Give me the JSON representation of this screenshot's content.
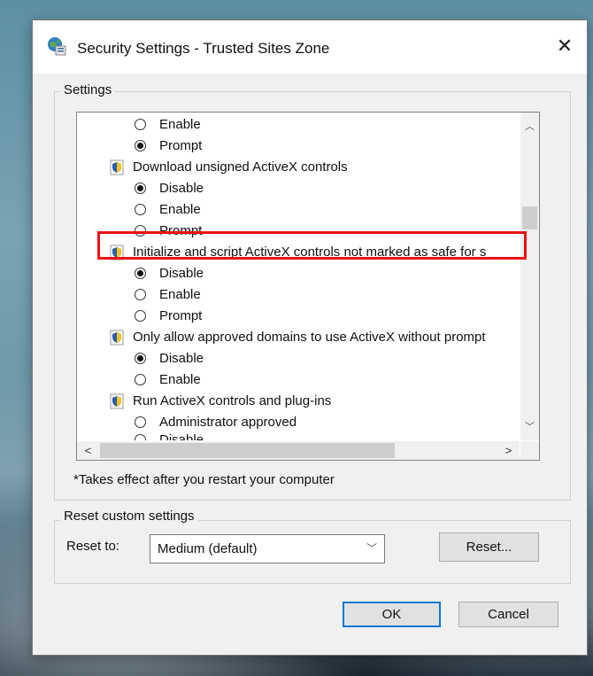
{
  "window": {
    "title": "Security Settings - Trusted Sites Zone",
    "close_symbol": "✕"
  },
  "settings": {
    "group_label": "Settings",
    "items": [
      {
        "type": "radio",
        "label": "Enable",
        "checked": false
      },
      {
        "type": "radio",
        "label": "Prompt",
        "checked": true
      },
      {
        "type": "header",
        "label": "Download unsigned ActiveX controls"
      },
      {
        "type": "radio",
        "label": "Disable",
        "checked": true
      },
      {
        "type": "radio",
        "label": "Enable",
        "checked": false
      },
      {
        "type": "radio",
        "label": "Prompt",
        "checked": false
      },
      {
        "type": "header",
        "label": "Initialize and script ActiveX controls not marked as safe for s"
      },
      {
        "type": "radio",
        "label": "Disable",
        "checked": true
      },
      {
        "type": "radio",
        "label": "Enable",
        "checked": false
      },
      {
        "type": "radio",
        "label": "Prompt",
        "checked": false
      },
      {
        "type": "header",
        "label": "Only allow approved domains to use ActiveX without prompt"
      },
      {
        "type": "radio",
        "label": "Disable",
        "checked": true
      },
      {
        "type": "radio",
        "label": "Enable",
        "checked": false
      },
      {
        "type": "header",
        "label": "Run ActiveX controls and plug-ins"
      },
      {
        "type": "radio",
        "label": "Administrator approved",
        "checked": false
      },
      {
        "type": "radio",
        "label": "Disable",
        "checked": false
      }
    ],
    "restart_note": "*Takes effect after you restart your computer"
  },
  "reset": {
    "group_label": "Reset custom settings",
    "reset_to_label": "Reset to:",
    "selected_level": "Medium (default)",
    "reset_button": "Reset..."
  },
  "footer": {
    "ok": "OK",
    "cancel": "Cancel"
  },
  "icons": {
    "title": "globe-shield-icon",
    "setting": "shield-icon"
  },
  "colors": {
    "highlight": "#ee1111",
    "accent": "#0078d7"
  }
}
